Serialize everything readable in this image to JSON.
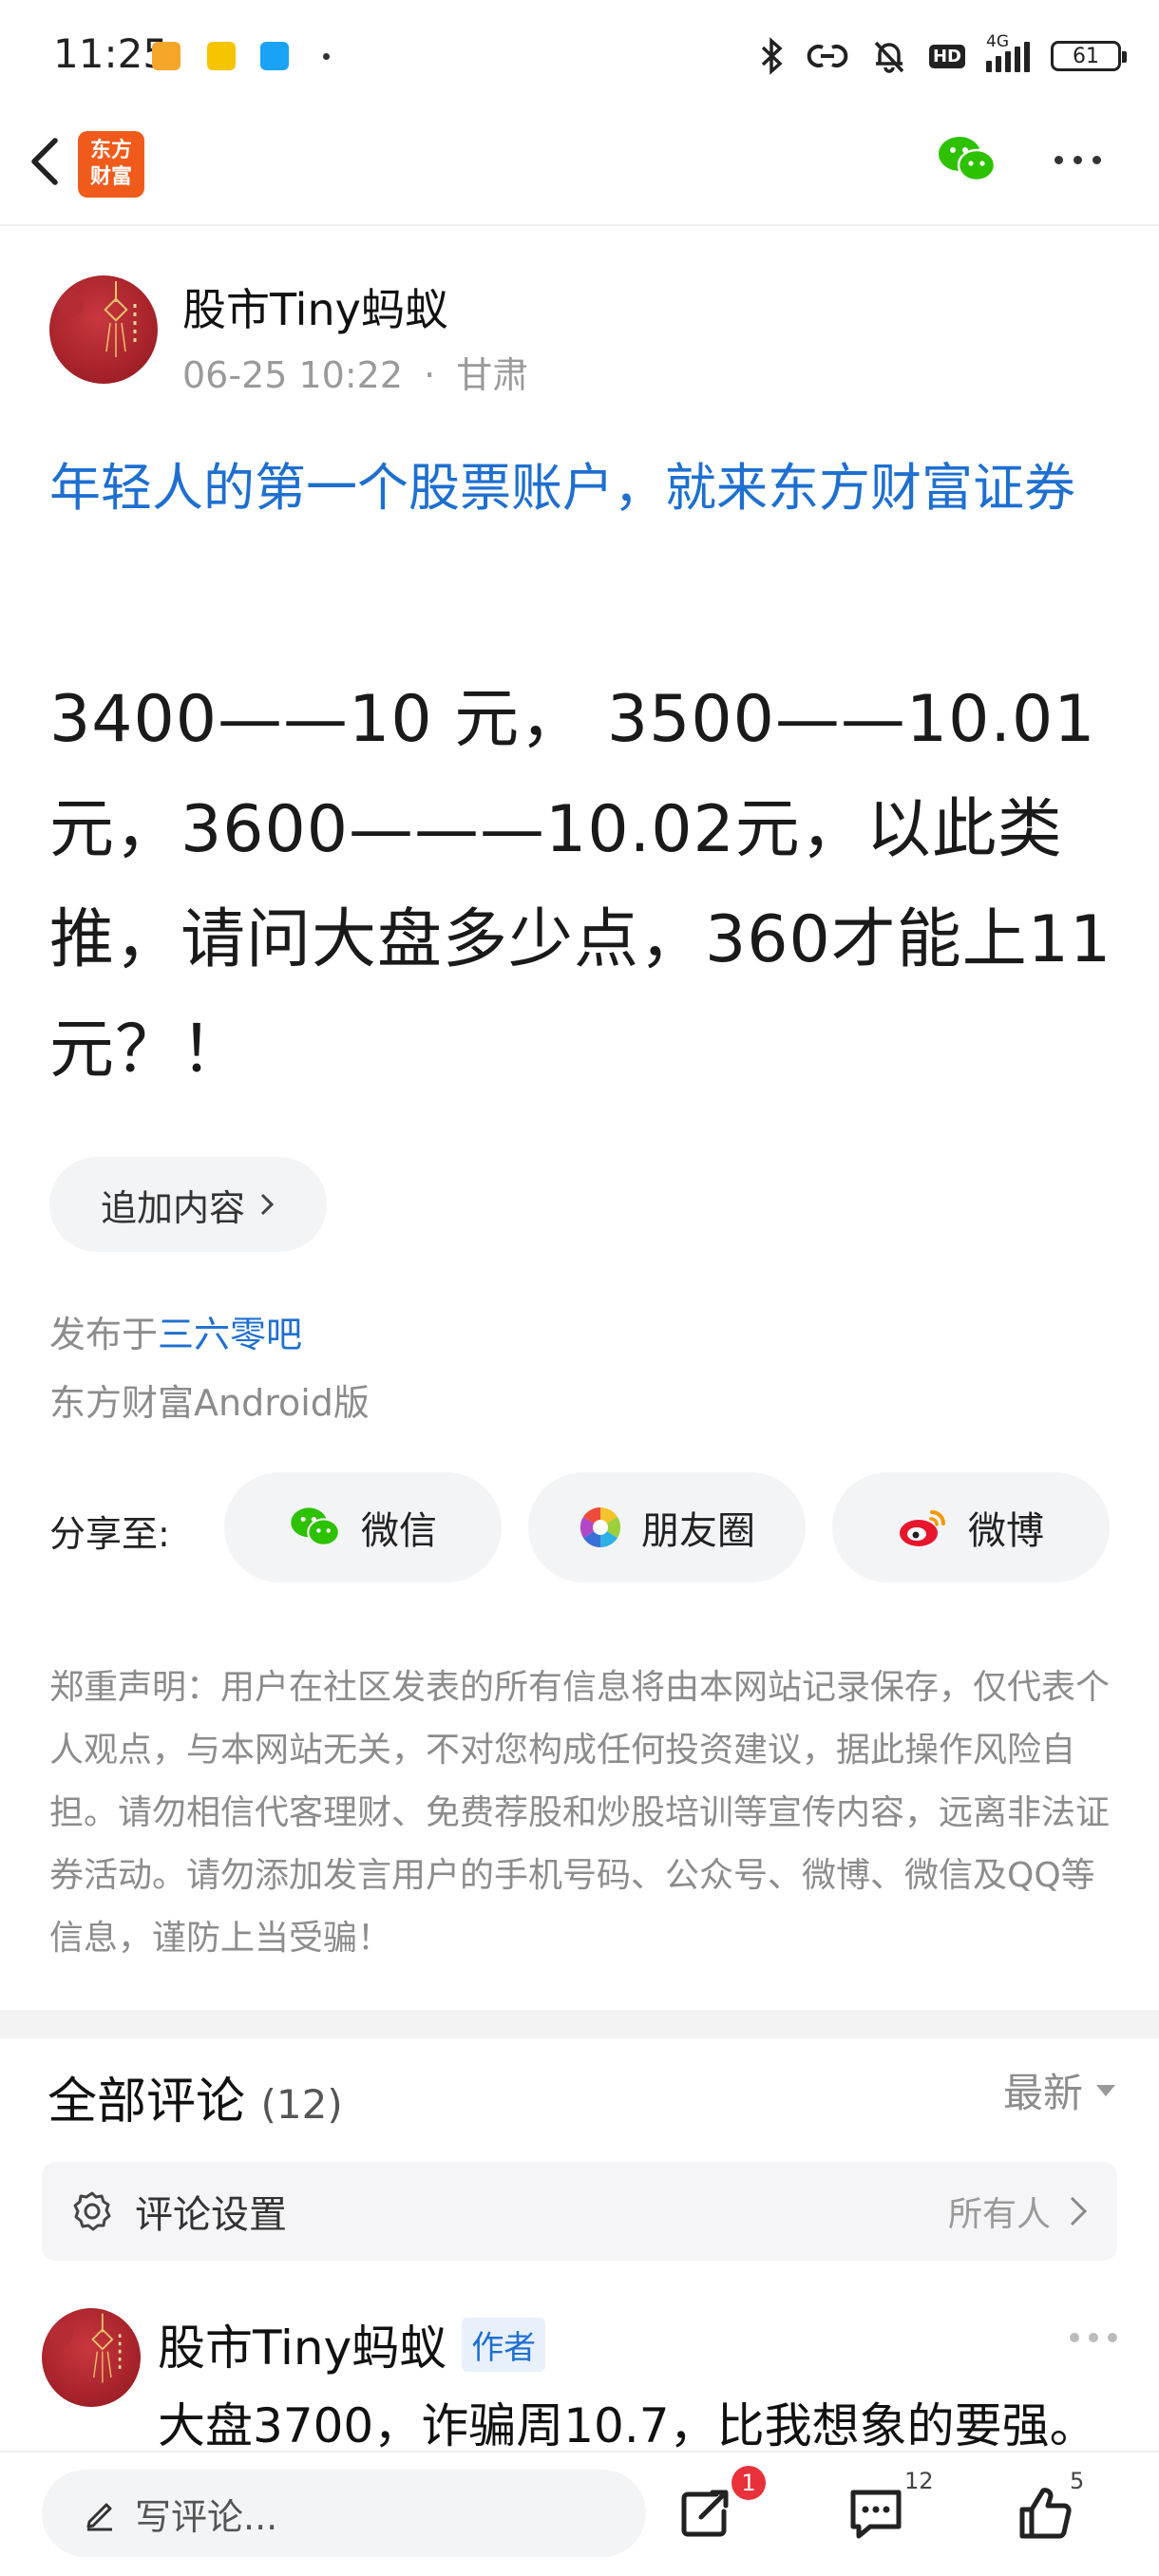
{
  "status_bar": {
    "time": "11:25",
    "network": "4G",
    "battery": "61",
    "hd": "HD"
  },
  "header": {
    "logo_text_line1": "东方",
    "logo_text_line2": "财富"
  },
  "post": {
    "author": "股市Tiny蚂蚁",
    "datetime": "06-25 10:22",
    "location": "甘肃",
    "meta_sep": "·",
    "title": "年轻人的第一个股票账户，就来东方财富证券",
    "body": "3400——10 元， 3500——10.01元，3600———10.02元，以此类推，请问大盘多少点，360才能上11元？！",
    "add_content_label": "追加内容",
    "published_in_prefix": "发布于",
    "published_in_bar": "三六零吧",
    "client": "东方财富Android版"
  },
  "share": {
    "label": "分享至:",
    "wechat": "微信",
    "moments": "朋友圈",
    "weibo": "微博"
  },
  "disclaimer": "郑重声明：用户在社区发表的所有信息将由本网站记录保存，仅代表个人观点，与本网站无关，不对您构成任何投资建议，据此操作风险自担。请勿相信代客理财、免费荐股和炒股培训等宣传内容，远离非法证券活动。请勿添加发言用户的手机号码、公众号、微博、微信及QQ等信息，谨防上当受骗！",
  "comments": {
    "title": "全部评论",
    "count": "(12)",
    "sort_label": "最新",
    "settings_label": "评论设置",
    "settings_value": "所有人",
    "first": {
      "author": "股市Tiny蚂蚁",
      "badge": "作者",
      "text": "大盘3700，诈骗周10.7，比我想象的要强。"
    }
  },
  "bottom_bar": {
    "input_placeholder": "写评论...",
    "share_badge": "1",
    "comment_count": "12",
    "like_count": "5"
  },
  "colors": {
    "link_blue": "#1e6fd0",
    "brand_orange": "#f05a1a",
    "wechat_green": "#2dc100",
    "badge_red": "#e8313b"
  }
}
